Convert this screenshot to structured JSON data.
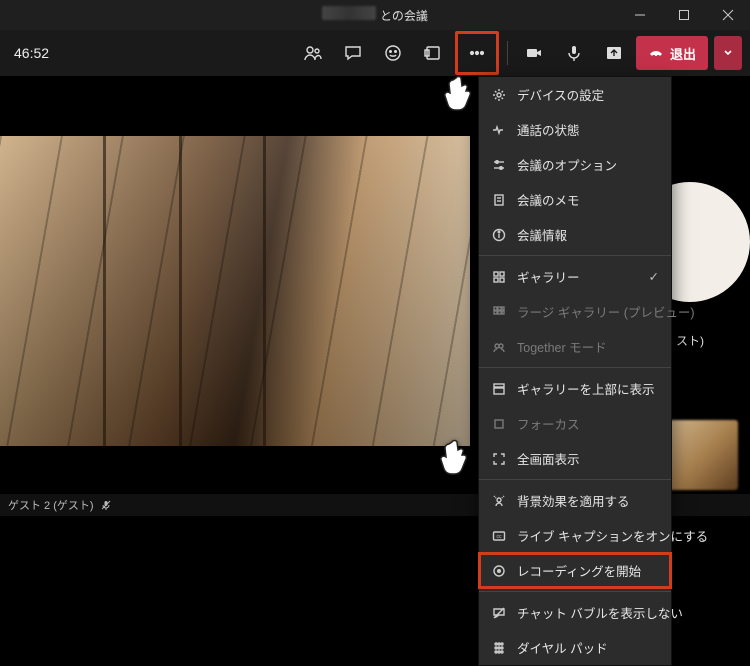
{
  "window": {
    "title_suffix": "との会議"
  },
  "toolbar": {
    "timer": "46:52",
    "leave_label": "退出"
  },
  "menu": {
    "device_settings": "デバイスの設定",
    "call_health": "通話の状態",
    "meeting_options": "会議のオプション",
    "meeting_notes": "会議のメモ",
    "meeting_info": "会議情報",
    "gallery": "ギャラリー",
    "large_gallery": "ラージ ギャラリー (プレビュー)",
    "together_mode": "Together モード",
    "gallery_top": "ギャラリーを上部に表示",
    "focus": "フォーカス",
    "fullscreen": "全画面表示",
    "background_effects": "背景効果を適用する",
    "live_captions": "ライブ キャプションをオンにする",
    "start_recording": "レコーディングを開始",
    "chat_bubble": "チャット バブルを表示しない",
    "dialpad": "ダイヤル パッド"
  },
  "participants": {
    "guest_suffix": "スト)",
    "bottom_label": "ゲスト 2 (ゲスト)"
  }
}
